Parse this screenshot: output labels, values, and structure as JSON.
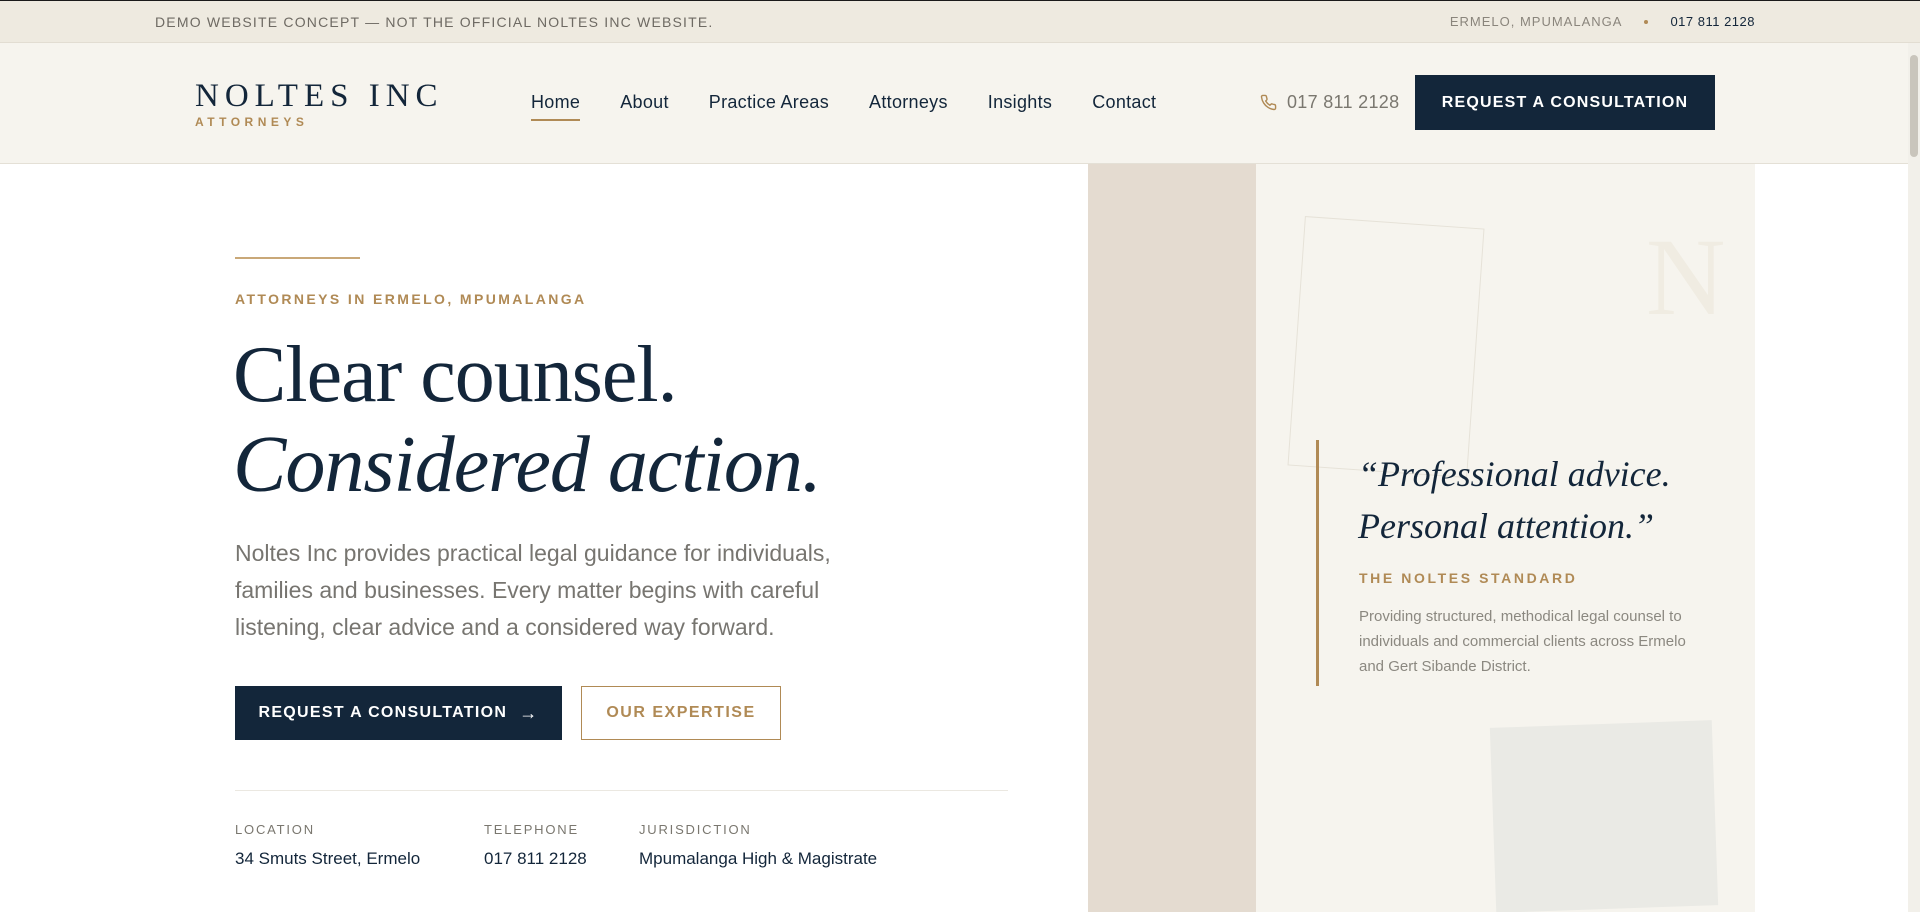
{
  "topbar": {
    "notice": "DEMO WEBSITE CONCEPT — NOT THE OFFICIAL NOLTES INC WEBSITE.",
    "location": "ERMELO, MPUMALANGA",
    "phone": "017 811 2128"
  },
  "header": {
    "logo_name": "NOLTES INC",
    "logo_sub": "ATTORNEYS",
    "nav": [
      "Home",
      "About",
      "Practice Areas",
      "Attorneys",
      "Insights",
      "Contact"
    ],
    "active_nav": "Home",
    "phone": "017 811 2128",
    "cta": "REQUEST A CONSULTATION"
  },
  "hero": {
    "eyebrow": "ATTORNEYS IN ERMELO, MPUMALANGA",
    "title_line1": "Clear counsel.",
    "title_line2": "Considered action.",
    "lead": "Noltes Inc provides practical legal guidance for individuals, families and businesses. Every matter begins with careful listening, clear advice and a considered way forward.",
    "primary_button": "REQUEST A CONSULTATION",
    "secondary_button": "OUR EXPERTISE",
    "meta": [
      {
        "label": "LOCATION",
        "value": "34 Smuts Street, Ermelo"
      },
      {
        "label": "TELEPHONE",
        "value": "017 811 2128"
      },
      {
        "label": "JURISDICTION",
        "value": "Mpumalanga High & Magistrate"
      }
    ]
  },
  "panel": {
    "watermark": "N",
    "quote_line1": "“Professional advice.",
    "quote_line2": "Personal attention.”",
    "standard_title": "THE NOLTES STANDARD",
    "standard_text": "Providing structured, methodical legal counsel to individuals and commercial clients across Ermelo and Gert Sibande District."
  },
  "colors": {
    "navy": "#13263a",
    "gold": "#b08a55",
    "cream": "#f6f4ee",
    "taupe": "#e4dbd0"
  }
}
